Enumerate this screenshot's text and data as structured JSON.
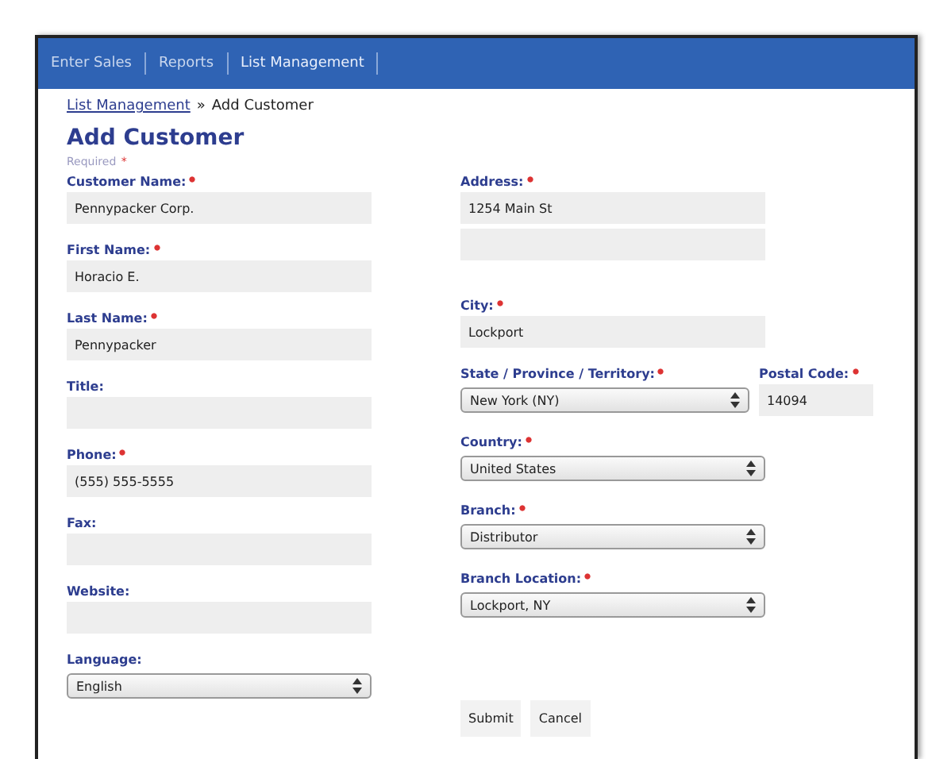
{
  "nav": [
    {
      "label": "Enter Sales",
      "selected": false
    },
    {
      "label": "Reports",
      "selected": false
    },
    {
      "label": "List Management",
      "selected": true
    }
  ],
  "breadcrumb": {
    "link": "List Management",
    "separator": "»",
    "current": "Add Customer"
  },
  "title": "Add Customer",
  "required_note": "Required",
  "required_note_mark": "*",
  "left": [
    [
      {
        "label": "Customer Name:",
        "required": true,
        "kind": "text",
        "value": "Pennypacker Corp."
      }
    ],
    [
      {
        "label": "First Name:",
        "required": true,
        "kind": "text",
        "value": "Horacio E."
      }
    ],
    [
      {
        "label": "Last Name:",
        "required": true,
        "kind": "text",
        "value": "Pennypacker"
      }
    ],
    [
      {
        "label": "Title:",
        "required": false,
        "kind": "text"
      }
    ],
    [
      {
        "label": "Phone:",
        "required": true,
        "kind": "text",
        "value": "(555) 555-5555"
      }
    ],
    [
      {
        "label": "Fax:",
        "required": false,
        "kind": "text"
      }
    ],
    [
      {
        "label": "Website:",
        "required": false,
        "kind": "text"
      }
    ],
    [
      {
        "label": "Language:",
        "required": false,
        "kind": "select",
        "value": "English"
      }
    ]
  ],
  "right": [
    [
      {
        "label": "Address:",
        "required": true,
        "kind": "text",
        "value": "1254 Main St",
        "extra_line": true
      }
    ],
    [
      {
        "label": "City:",
        "required": true,
        "kind": "text",
        "value": "Lockport"
      }
    ],
    [
      {
        "label": "State / Province / Territory:",
        "required": true,
        "kind": "select",
        "value": "New York (NY)"
      },
      {
        "label": "Postal Code:",
        "required": true,
        "kind": "short",
        "value": "14094"
      }
    ],
    [
      {
        "label": "Country:",
        "required": true,
        "kind": "select",
        "value": "United States"
      }
    ],
    [
      {
        "label": "Branch:",
        "required": true,
        "kind": "select",
        "value": "Distributor"
      }
    ],
    [
      {
        "label": "Branch Location:",
        "required": true,
        "kind": "select",
        "value": "Lockport, NY"
      }
    ]
  ],
  "buttons": [
    "Submit",
    "Cancel"
  ]
}
